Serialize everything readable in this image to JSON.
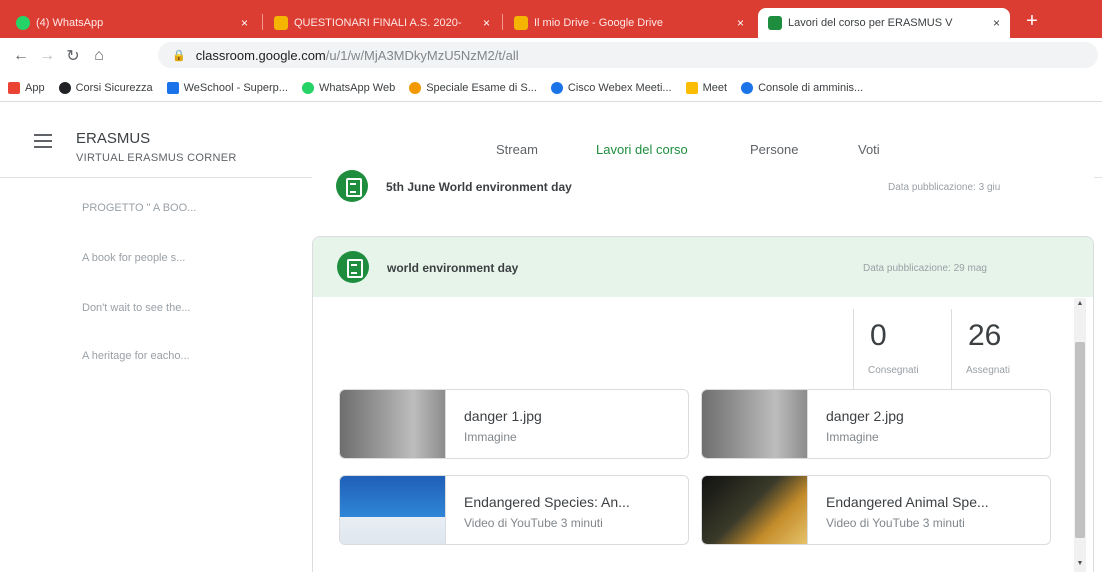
{
  "browser": {
    "tabs": [
      {
        "label": "(4) WhatsApp",
        "icon": "whatsapp-icon",
        "color": "#25d366"
      },
      {
        "label": "QUESTIONARI FINALI A.S. 2020-",
        "icon": "drive-icon",
        "color": "#f4b400"
      },
      {
        "label": "Il mio Drive - Google Drive",
        "icon": "drive-icon",
        "color": "#f4b400"
      },
      {
        "label": "Lavori del corso per ERASMUS V",
        "icon": "classroom-icon",
        "color": "#1e8e3e"
      }
    ],
    "new_tab": "+",
    "close_glyph": "×",
    "url_host": "classroom.google.com",
    "url_path": "/u/1/w/MjA3MDkyMzU5NzM2/t/all",
    "bookmarks": [
      {
        "label": "App",
        "color": "#ea4335"
      },
      {
        "label": "Corsi Sicurezza",
        "color": "#202124"
      },
      {
        "label": "WeSchool - Superp...",
        "color": "#1a73e8"
      },
      {
        "label": "WhatsApp Web",
        "color": "#25d366"
      },
      {
        "label": "Speciale Esame di S...",
        "color": "#f29900"
      },
      {
        "label": "Cisco Webex Meeti...",
        "color": "#1a73e8"
      },
      {
        "label": "Meet",
        "color": "#fbbc04"
      },
      {
        "label": "Console di amminis...",
        "color": "#1a73e8"
      }
    ]
  },
  "classroom": {
    "class_name": "ERASMUS",
    "class_section": "VIRTUAL ERASMUS CORNER",
    "tabs": [
      "Stream",
      "Lavori del corso",
      "Persone",
      "Voti"
    ],
    "active_tab": "Lavori del corso",
    "accent": "#1e8e3e",
    "sidebar_topics": [
      "PROGETTO \" A BOO...",
      "A book for people s...",
      "Don't wait to see the...",
      "A heritage for eacho..."
    ]
  },
  "assignments": [
    {
      "title": "5th June World environment day",
      "date": "Data pubblicazione: 3 giu"
    },
    {
      "title": "world environment day",
      "date": "Data pubblicazione: 29 mag",
      "turned_in": "0",
      "turned_in_label": "Consegnati",
      "assigned": "26",
      "assigned_label": "Assegnati",
      "attachments": [
        {
          "name": "danger 1.jpg",
          "type": "Immagine"
        },
        {
          "name": "danger 2.jpg",
          "type": "Immagine"
        },
        {
          "name": "Endangered Species: An...",
          "type": "Video di YouTube   3 minuti"
        },
        {
          "name": "Endangered Animal Spe...",
          "type": "Video di YouTube   3 minuti"
        }
      ]
    }
  ]
}
